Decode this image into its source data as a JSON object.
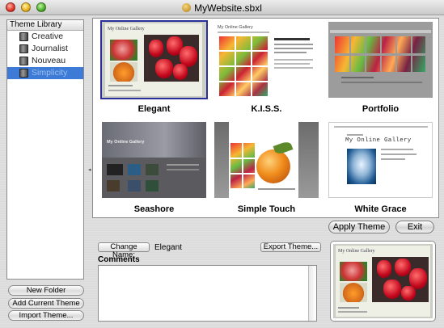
{
  "window": {
    "title": "MyWebsite.sbxl"
  },
  "sidebar": {
    "header": "Theme Library",
    "items": [
      {
        "label": "Creative"
      },
      {
        "label": "Journalist"
      },
      {
        "label": "Nouveau Noir"
      },
      {
        "label": "Simplicity"
      }
    ]
  },
  "left_buttons": {
    "new_folder": "New Folder",
    "add_current": "Add Current Theme",
    "import": "Import Theme..."
  },
  "themes": [
    {
      "label": "Elegant"
    },
    {
      "label": "K.I.S.S."
    },
    {
      "label": "Portfolio"
    },
    {
      "label": "Seashore"
    },
    {
      "label": "Simple Touch"
    },
    {
      "label": "White Grace"
    }
  ],
  "thumb_text": {
    "elegant_title": "My Online Gallery",
    "seashore_title": "My Online Gallery",
    "kiss_title": "My Online Gallery",
    "white_grace_title": "My Online Gallery",
    "preview_title": "My Online Gallery"
  },
  "actions": {
    "apply": "Apply Theme",
    "exit": "Exit"
  },
  "details": {
    "change_name_label": "Change Name:",
    "theme_name": "Elegant",
    "export_label": "Export Theme...",
    "comments_label": "Comments"
  },
  "colors": {
    "selection": "#3e7bd6",
    "selected_thumb_outline": "#2b2f9a"
  }
}
